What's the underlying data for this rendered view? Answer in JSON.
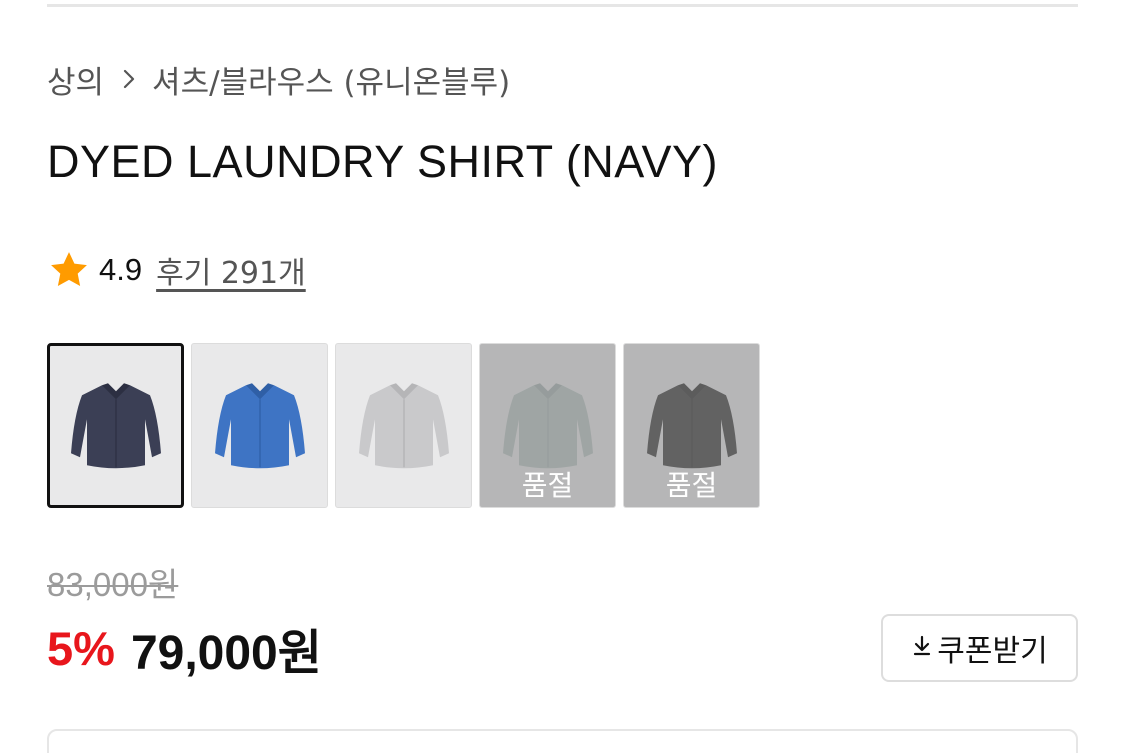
{
  "breadcrumb": {
    "category": "상의",
    "subcategory": "셔츠/블라우스 (유니온블루)"
  },
  "product": {
    "title": "DYED LAUNDRY SHIRT (NAVY)"
  },
  "rating": {
    "score": "4.9",
    "reviews_label": "후기 291개"
  },
  "swatches": [
    {
      "color": "#3b3f55",
      "selected": true,
      "sold_out": false
    },
    {
      "color": "#3e74c4",
      "selected": false,
      "sold_out": false
    },
    {
      "color": "#c9c9cb",
      "selected": false,
      "sold_out": false
    },
    {
      "color": "#b7c3c2",
      "selected": false,
      "sold_out": true,
      "sold_out_label": "품절"
    },
    {
      "color": "#2f2f30",
      "selected": false,
      "sold_out": true,
      "sold_out_label": "품절"
    }
  ],
  "price": {
    "original": "83,000원",
    "discount": "5%",
    "sale": "79,000원"
  },
  "coupon": {
    "label": "쿠폰받기",
    "icon": "download-icon"
  },
  "colors": {
    "star": "#ff9b00",
    "discount": "#e8161c"
  }
}
